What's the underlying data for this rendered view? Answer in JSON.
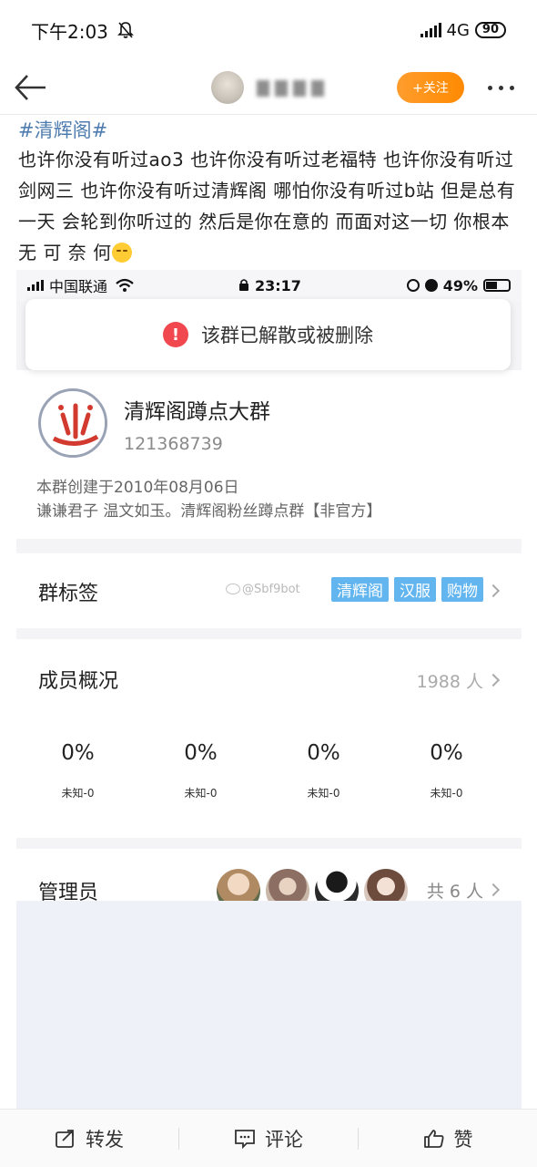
{
  "status_bar": {
    "time": "下午2:03",
    "network": "4G",
    "battery": "90"
  },
  "nav": {
    "follow_label": "+关注"
  },
  "post": {
    "topic": "#清辉阁#",
    "text": "也许你没有听过ao3 也许你没有听过老福特 也许你没有听过剑网三 也许你没有听过清辉阁 哪怕你没有听过b站 但是总有一天 会轮到你听过的 然后是你在意的 而面对这一切 你根本无 可 奈 何"
  },
  "screenshot": {
    "status_bar": {
      "carrier": "中国联通",
      "time": "23:17",
      "battery": "49%"
    },
    "toast": {
      "icon": "!",
      "message": "该群已解散或被删除"
    },
    "group": {
      "name": "清辉阁蹲点大群",
      "id": "121368739",
      "created": "本群创建于2010年08月06日",
      "description": "谦谦君子 温文如玉。清辉阁粉丝蹲点群【非官方】"
    },
    "tags_section": {
      "label": "群标签",
      "watermark": "@Sbf9bot",
      "tags": [
        "清辉阁",
        "汉服",
        "购物"
      ]
    },
    "members_section": {
      "label": "成员概况",
      "count": "1988 人",
      "stats": [
        {
          "value": "0%",
          "label": "未知-0"
        },
        {
          "value": "0%",
          "label": "未知-0"
        },
        {
          "value": "0%",
          "label": "未知-0"
        },
        {
          "value": "0%",
          "label": "未知-0"
        }
      ]
    },
    "admins_section": {
      "label": "管理员",
      "total": "共 6 人"
    }
  },
  "bottom_bar": {
    "repost": "转发",
    "comment": "评论",
    "like": "赞"
  },
  "colors": {
    "topic": "#507daf",
    "follow": "#ff9000",
    "tag": "#62b5ef",
    "error": "#f0484e"
  }
}
